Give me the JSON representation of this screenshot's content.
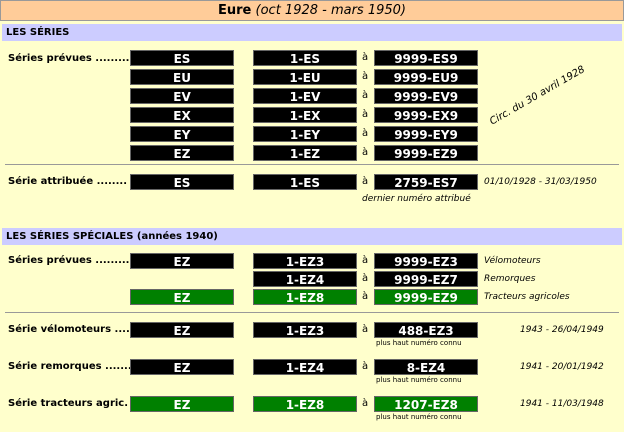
{
  "header": {
    "name": "Eure",
    "period": "(oct 1928 - mars 1950)"
  },
  "section1": {
    "title": "LES SÉRIES",
    "prevues_label": "Séries prévues .........",
    "rows": [
      {
        "serie": "ES",
        "from": "1-ES",
        "a": "à",
        "to": "9999-ES9"
      },
      {
        "serie": "EU",
        "from": "1-EU",
        "a": "à",
        "to": "9999-EU9"
      },
      {
        "serie": "EV",
        "from": "1-EV",
        "a": "à",
        "to": "9999-EV9"
      },
      {
        "serie": "EX",
        "from": "1-EX",
        "a": "à",
        "to": "9999-EX9"
      },
      {
        "serie": "EY",
        "from": "1-EY",
        "a": "à",
        "to": "9999-EY9"
      },
      {
        "serie": "EZ",
        "from": "1-EZ",
        "a": "à",
        "to": "9999-EZ9"
      }
    ],
    "circ_note": "Circ. du 30 avril 1928",
    "attribuee": {
      "label": "Série attribuée ........",
      "serie": "ES",
      "from": "1-ES",
      "a": "à",
      "to": "2759-ES7",
      "dates": "01/10/1928 - 31/03/1950",
      "last_note": "dernier numéro attribué"
    }
  },
  "section2": {
    "title": "LES SÉRIES SPÉCIALES (années 1940)",
    "prevues_label": "Séries prévues .........",
    "rows": [
      {
        "serie": "EZ",
        "from": "1-EZ3",
        "a": "à",
        "to": "9999-EZ3",
        "note": "Vélomoteurs",
        "green": false
      },
      {
        "serie": "",
        "from": "1-EZ4",
        "a": "à",
        "to": "9999-EZ7",
        "note": "Remorques",
        "green": false
      },
      {
        "serie": "EZ",
        "from": "1-EZ8",
        "a": "à",
        "to": "9999-EZ9",
        "note": "Tracteurs agricoles",
        "green": true
      }
    ],
    "details": [
      {
        "label": "Série vélomoteurs ....",
        "serie": "EZ",
        "from": "1-EZ3",
        "a": "à",
        "to": "488-EZ3",
        "dates": "1943 - 26/04/1949",
        "note": "plus haut numéro connu",
        "green": false
      },
      {
        "label": "Série remorques .......",
        "serie": "EZ",
        "from": "1-EZ4",
        "a": "à",
        "to": "8-EZ4",
        "dates": "1941 - 20/01/1942",
        "note": "plus haut numéro connu",
        "green": false
      },
      {
        "label": "Série tracteurs agric.",
        "serie": "EZ",
        "from": "1-EZ8",
        "a": "à",
        "to": "1207-EZ8",
        "dates": "1941 - 11/03/1948",
        "note": "plus haut numéro connu",
        "green": true
      }
    ]
  }
}
